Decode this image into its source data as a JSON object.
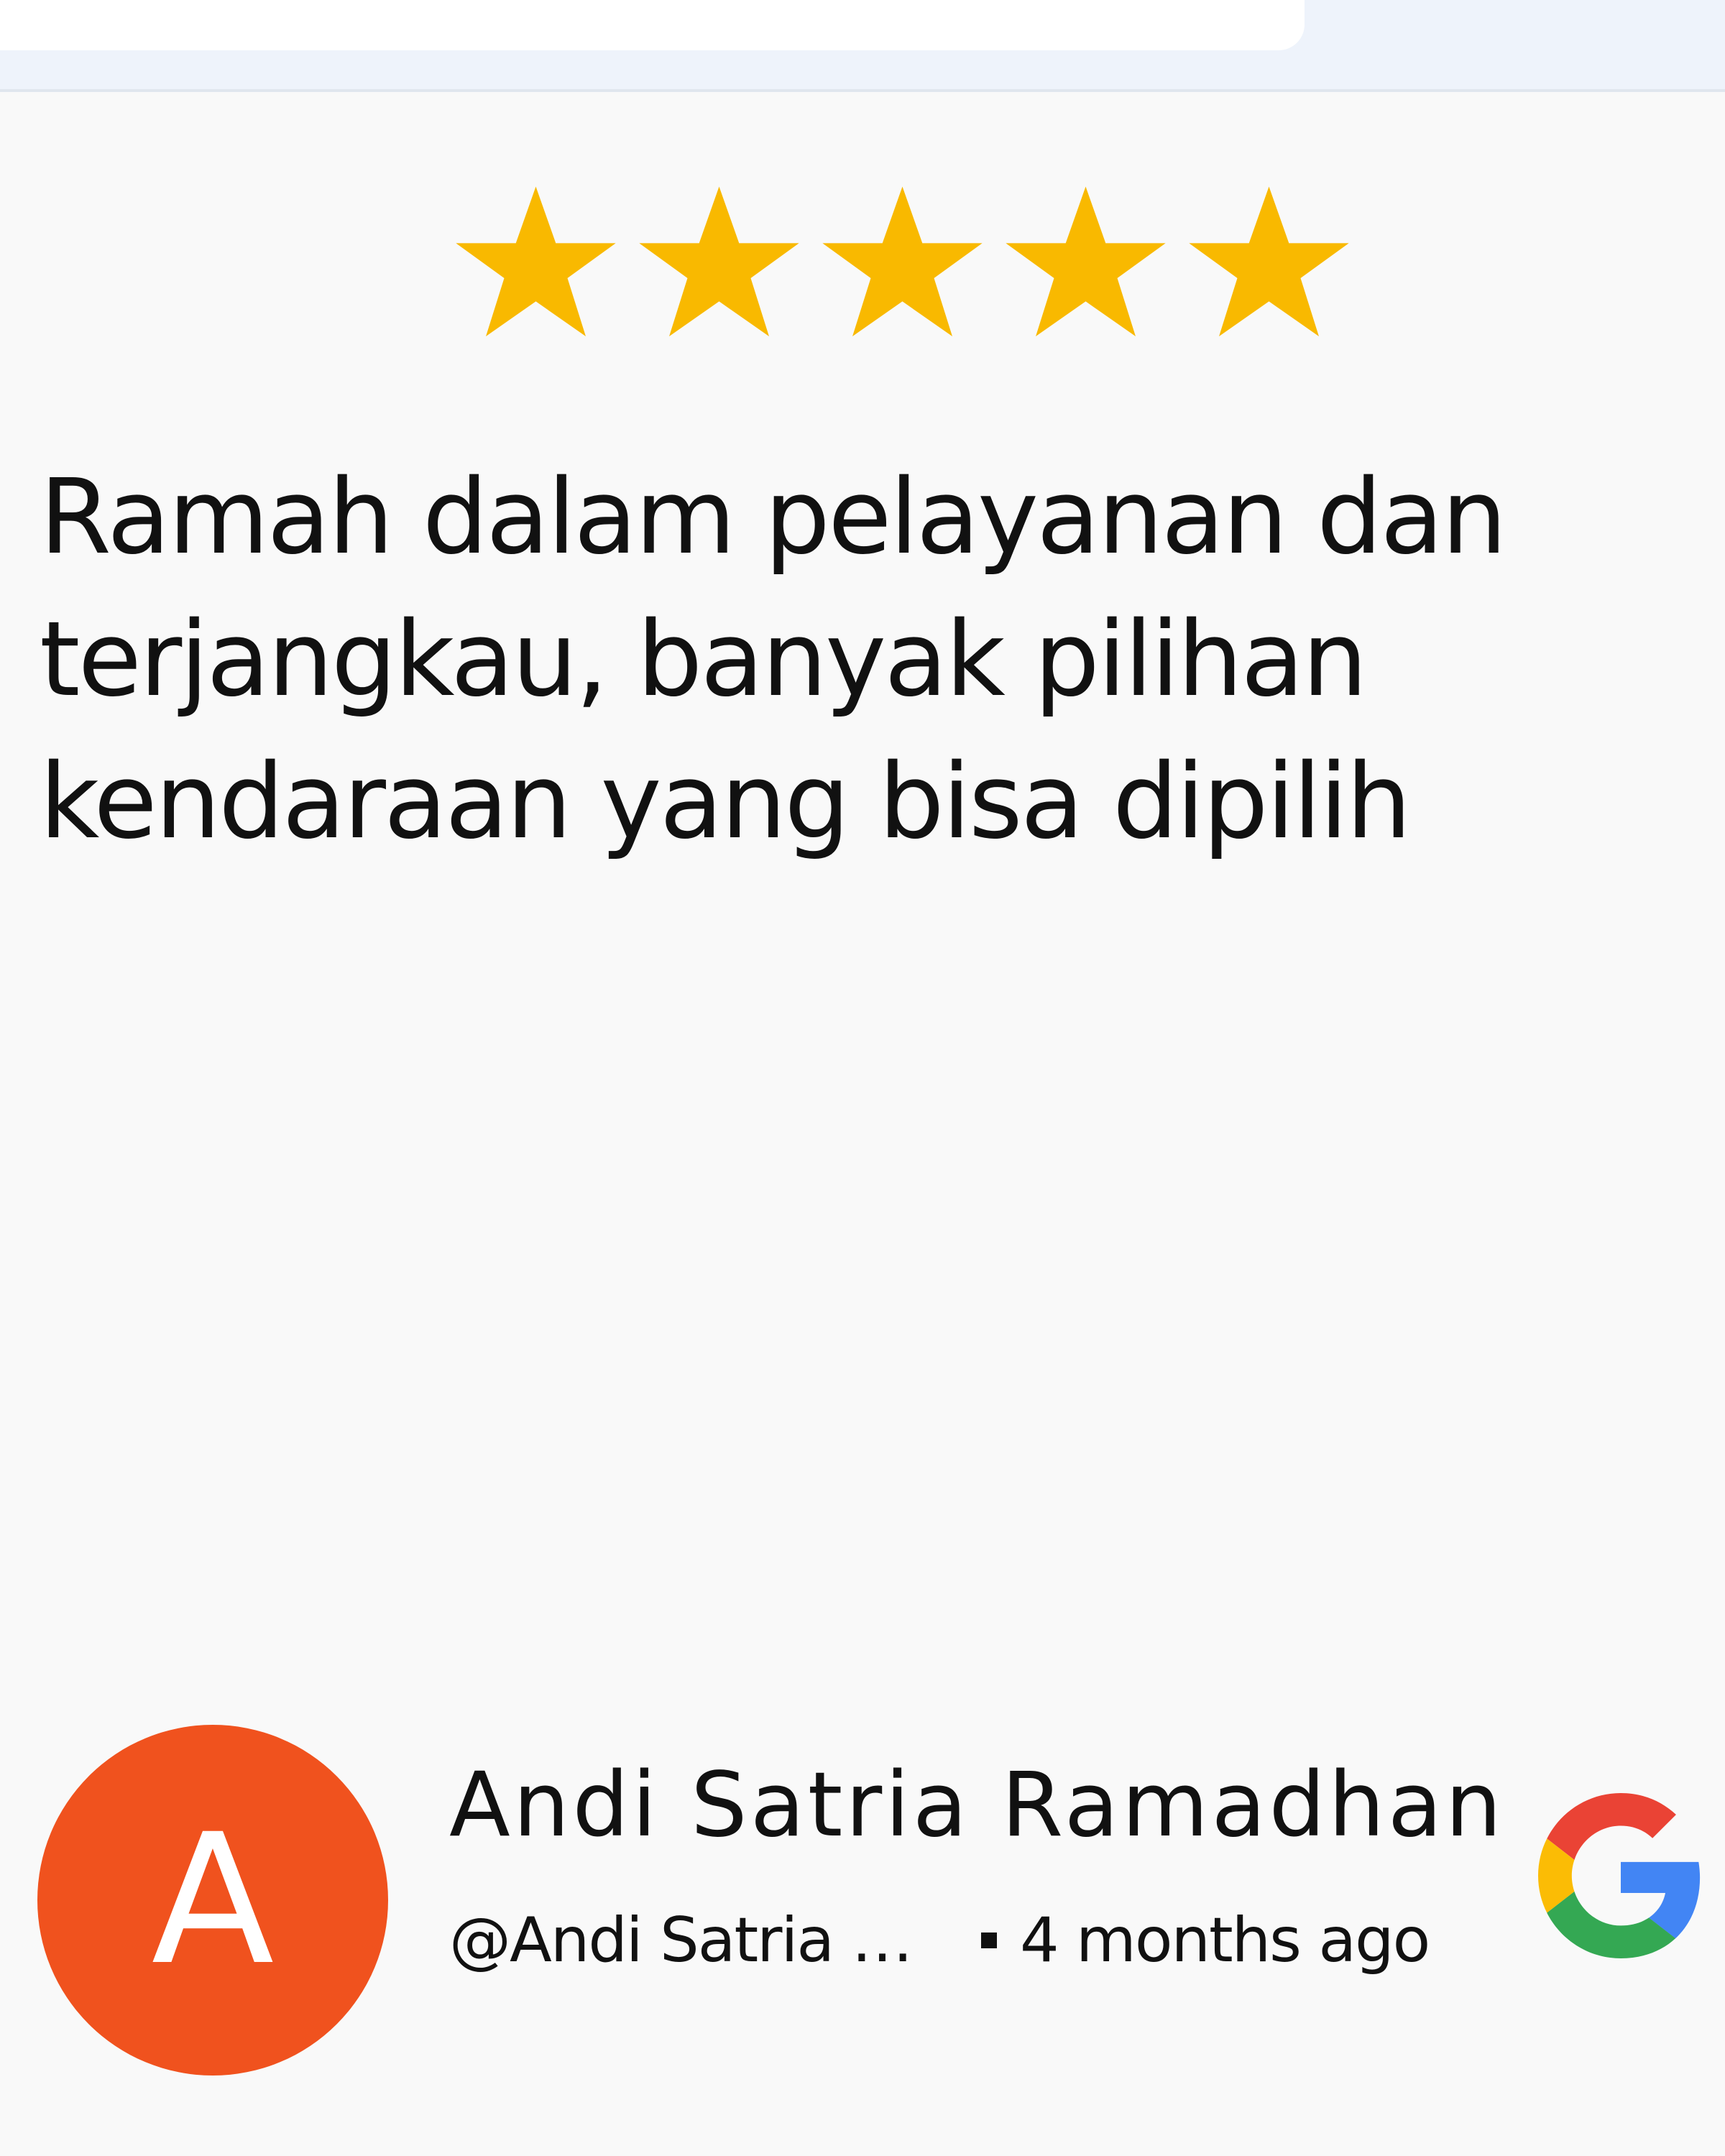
{
  "review": {
    "rating": 5,
    "max_rating": 5,
    "star_color": "#f9b900",
    "text": "Ramah dalam pelayanan dan terjangkau, banyak pilihan kendaraan yang bisa dipilih"
  },
  "author": {
    "avatar_letter": "A",
    "avatar_color": "#f0521e",
    "name": "Andi Satria Ramadhan",
    "handle": "@Andi Satria R...",
    "time_ago": "4 months ago"
  },
  "source": {
    "icon": "google-g-icon"
  }
}
